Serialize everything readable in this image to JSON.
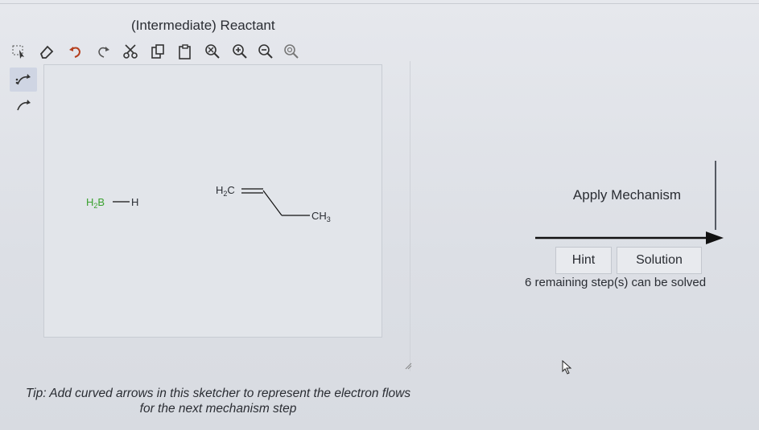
{
  "header": {
    "title": "(Intermediate) Reactant"
  },
  "toolbar": {
    "tools": [
      {
        "name": "select-tool"
      },
      {
        "name": "erase-tool"
      },
      {
        "name": "undo"
      },
      {
        "name": "redo"
      },
      {
        "name": "cut"
      },
      {
        "name": "copy"
      },
      {
        "name": "paste"
      },
      {
        "name": "zoom-reset"
      },
      {
        "name": "zoom-in"
      },
      {
        "name": "zoom-out"
      },
      {
        "name": "zoom-fit"
      }
    ]
  },
  "side_tools": [
    {
      "name": "curved-arrow-pair",
      "active": true
    },
    {
      "name": "curved-arrow-single",
      "active": false
    }
  ],
  "molecules": {
    "borane": {
      "left": "H",
      "left_sub": "2",
      "center": "B",
      "right": "H"
    },
    "propene": {
      "ch2": "H",
      "ch2_sub": "2",
      "ch2_c": "C",
      "ch3": "CH",
      "ch3_sub": "3"
    }
  },
  "colors": {
    "boron": "#3aa12f",
    "text": "#2a2d33",
    "bond": "#111111"
  },
  "actions": {
    "apply_label": "Apply Mechanism",
    "hint_label": "Hint",
    "solution_label": "Solution",
    "remaining_text": "6 remaining step(s) can be solved"
  },
  "tip": {
    "line1": "Tip: Add curved arrows in this sketcher to represent the electron flows",
    "line2": "for the next mechanism step"
  }
}
